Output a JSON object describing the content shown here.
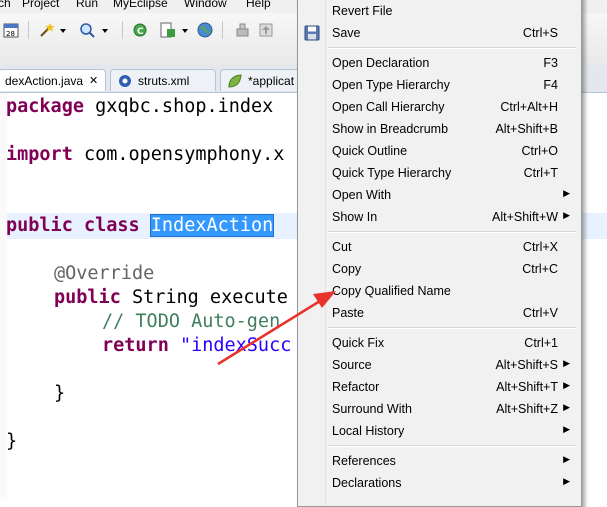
{
  "menubar": {
    "items": [
      "ch",
      "Project",
      "Run",
      "MyEclipse",
      "Window",
      "Help"
    ]
  },
  "tabs": [
    {
      "label": "dexAction.java",
      "close": "✕"
    },
    {
      "label": "struts.xml"
    },
    {
      "label": "*applicat"
    }
  ],
  "code": {
    "line1_kw": "package",
    "line1_rest": " gxqbc.shop.index",
    "line2_kw": "import",
    "line2_rest": " com.opensymphony.x",
    "line3_kw": "public class",
    "line3_sel": "IndexAction",
    "line4_ann": "@Override",
    "line5_kw": "public",
    "line5_rest": " String execute",
    "line6_cmt": "// TODO Auto-gen",
    "line7_kw": "return",
    "line7_str": " \"indexSucc",
    "line8": "}",
    "line9": "}"
  },
  "context_menu": {
    "items": [
      {
        "label": "Revert File",
        "accel": ""
      },
      {
        "label": "Save",
        "accel": "Ctrl+S"
      },
      {
        "label": "Open Declaration",
        "accel": "F3"
      },
      {
        "label": "Open Type Hierarchy",
        "accel": "F4"
      },
      {
        "label": "Open Call Hierarchy",
        "accel": "Ctrl+Alt+H"
      },
      {
        "label": "Show in Breadcrumb",
        "accel": "Alt+Shift+B"
      },
      {
        "label": "Quick Outline",
        "accel": "Ctrl+O"
      },
      {
        "label": "Quick Type Hierarchy",
        "accel": "Ctrl+T"
      },
      {
        "label": "Open With",
        "accel": ""
      },
      {
        "label": "Show In",
        "accel": "Alt+Shift+W"
      },
      {
        "label": "Cut",
        "accel": "Ctrl+X"
      },
      {
        "label": "Copy",
        "accel": "Ctrl+C"
      },
      {
        "label": "Copy Qualified Name",
        "accel": ""
      },
      {
        "label": "Paste",
        "accel": "Ctrl+V"
      },
      {
        "label": "Quick Fix",
        "accel": "Ctrl+1"
      },
      {
        "label": "Source",
        "accel": "Alt+Shift+S"
      },
      {
        "label": "Refactor",
        "accel": "Alt+Shift+T"
      },
      {
        "label": "Surround With",
        "accel": "Alt+Shift+Z"
      },
      {
        "label": "Local History",
        "accel": ""
      },
      {
        "label": "References",
        "accel": ""
      },
      {
        "label": "Declarations",
        "accel": ""
      }
    ],
    "submenu_arrow": "▶"
  },
  "colors": {
    "keyword": "#7f0055",
    "annotation": "#646464",
    "comment": "#3f7f5f",
    "string": "#2a00ff",
    "selection": "#3399ff",
    "annotation_arrow": "#e8322c"
  }
}
